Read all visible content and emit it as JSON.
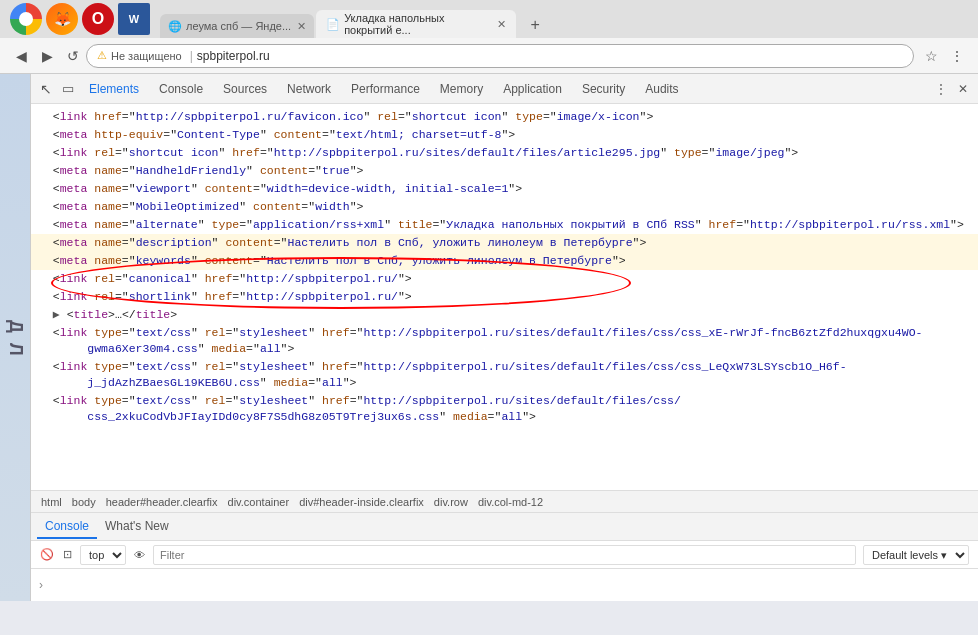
{
  "browser": {
    "icons": [
      "chrome",
      "firefox",
      "opera",
      "word"
    ],
    "tabs": [
      {
        "label": "леума спб — Янде...",
        "active": false,
        "favicon": "🌐"
      },
      {
        "label": "Укладка напольных покрытий е...",
        "active": true,
        "favicon": "📄"
      }
    ],
    "new_tab_label": "+",
    "address_bar": {
      "lock": "⚠",
      "not_secure": "Не защищено",
      "separator": "|",
      "url": "spbpiterpol.ru"
    }
  },
  "devtools": {
    "toolbar_icons": [
      "cursor",
      "box"
    ],
    "tabs": [
      {
        "label": "Elements",
        "active": true
      },
      {
        "label": "Console",
        "active": false
      },
      {
        "label": "Sources",
        "active": false
      },
      {
        "label": "Network",
        "active": false
      },
      {
        "label": "Performance",
        "active": false
      },
      {
        "label": "Memory",
        "active": false
      },
      {
        "label": "Application",
        "active": false
      },
      {
        "label": "Security",
        "active": false
      },
      {
        "label": "Audits",
        "active": false
      }
    ],
    "code_lines": [
      {
        "indent": 2,
        "content": "<link href=\"http://spbpiterpol.ru/favicon.ico\" rel=\"shortcut icon\" type=\"image/x-icon\">",
        "hasLink": true,
        "link": "http://spbpiterpol.ru/favicon.ico"
      },
      {
        "indent": 2,
        "content": "<meta http-equiv=\"Content-Type\" content=\"text/html; charset=utf-8\">"
      },
      {
        "indent": 2,
        "content": "<link rel=\"shortcut icon\" href=\"http://spbpiterpol.ru/sites/default/files/article295.jpg\" type=\"image/jpeg\">",
        "hasLink": true,
        "link": "http://spbpiterpol.ru/sites/default/files/article295.jpg"
      },
      {
        "indent": 2,
        "content": "<meta name=\"HandheldFriendly\" content=\"true\">"
      },
      {
        "indent": 2,
        "content": "<meta name=\"viewport\" content=\"width=device-width, initial-scale=1\">"
      },
      {
        "indent": 2,
        "content": "<meta name=\"MobileOptimized\" content=\"width\">"
      },
      {
        "indent": 2,
        "content": "<meta name=\"alternate\" type=\"application/rss+xml\" title=\"Укладка напольных покрытий в СПб RSS\" href=\"http://spbpiterpol.ru/rss.xml\">",
        "hasLink": true,
        "link": "http://spbpiterpol.ru/rss.xml"
      },
      {
        "indent": 2,
        "content": "<meta name=\"description\" content=\"Настелить пол в Спб, уложить линолеум в Петербурге\">",
        "highlighted": true
      },
      {
        "indent": 2,
        "content": "<meta name=\"keywords\" content=\"Настелить пол в Спб, уложить линолеум в Петербурге\">",
        "highlighted": true
      },
      {
        "indent": 2,
        "content": "<link rel=\"canonical\" href=\"http://spbpiterpol.ru/\">",
        "hasLink": true,
        "link": "http://spbpiterpol.ru/"
      },
      {
        "indent": 2,
        "content": "<link rel=\"shortlink\" href=\"http://spbpiterpol.ru/\">",
        "hasLink": true,
        "link": "http://spbpiterpol.ru/"
      },
      {
        "indent": 2,
        "content": "▶ <title>…</title>"
      },
      {
        "indent": 2,
        "content": "<link type=\"text/css\" rel=\"stylesheet\" href=\"http://spbpiterpol.ru/sites/default/files/css/css_xE-rWrJf-fncB6ztZfd2huxqgxu4WO-gwma6Xer30m4.css\" media=\"all\">",
        "hasLink": true
      },
      {
        "indent": 2,
        "content": "<link type=\"text/css\" rel=\"stylesheet\" href=\"http://spbpiterpol.ru/sites/default/files/css/css_LeQxW73LSYscb1O_H6f-j_jdAzhZBaesGL19KEB6U.css\" media=\"all\">",
        "hasLink": true
      },
      {
        "indent": 2,
        "content": "<link type=\"text/css\" rel=\"stylesheet\" href=\"http://spbpiterpol.ru/sites/default/files/css/css_2xkuCodVbJFIayIDd0cy8F7S5dhG8z05T9Trej3ux6s.css\" media=\"all\">",
        "hasLink": true
      }
    ],
    "breadcrumbs": [
      "html",
      "body",
      "header#header.clearfix",
      "div.container",
      "div#header-inside.clearfix",
      "div.row",
      "div.col-md-12"
    ],
    "bottom_tabs": [
      {
        "label": "Console",
        "active": true
      },
      {
        "label": "What's New",
        "active": false
      }
    ],
    "console_toolbar": {
      "clear_btn": "🚫",
      "top_select": "top",
      "filter_placeholder": "Filter",
      "level_select": "Default levels ▾"
    },
    "console_arrow": "›"
  },
  "page": {
    "letters": [
      "Д",
      "Л"
    ]
  }
}
